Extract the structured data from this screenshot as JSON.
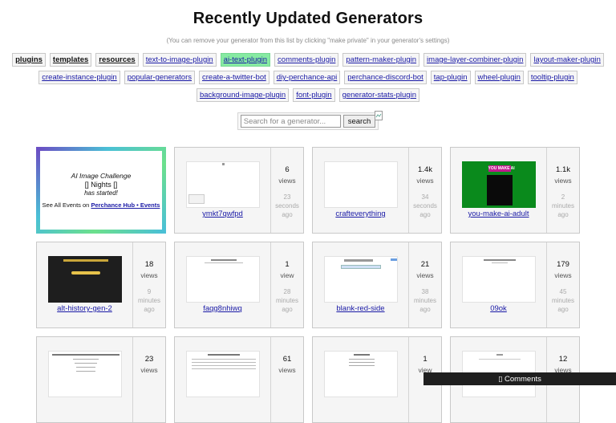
{
  "page": {
    "title": "Recently Updated Generators",
    "subtitle": "(You can remove your generator from this list by clicking \"make private\" in your generator's settings)"
  },
  "tags": [
    {
      "label": "plugins",
      "style": "bold"
    },
    {
      "label": "templates",
      "style": "bold"
    },
    {
      "label": "resources",
      "style": "bold"
    },
    {
      "label": "text-to-image-plugin",
      "style": "normal"
    },
    {
      "label": "ai-text-plugin",
      "style": "active"
    },
    {
      "label": "comments-plugin",
      "style": "normal"
    },
    {
      "label": "pattern-maker-plugin",
      "style": "normal"
    },
    {
      "label": "image-layer-combiner-plugin",
      "style": "normal"
    },
    {
      "label": "layout-maker-plugin",
      "style": "normal"
    },
    {
      "label": "create-instance-plugin",
      "style": "normal"
    },
    {
      "label": "popular-generators",
      "style": "normal"
    },
    {
      "label": "create-a-twitter-bot",
      "style": "normal"
    },
    {
      "label": "diy-perchance-api",
      "style": "normal"
    },
    {
      "label": "perchance-discord-bot",
      "style": "normal"
    },
    {
      "label": "tap-plugin",
      "style": "normal"
    },
    {
      "label": "wheel-plugin",
      "style": "normal"
    },
    {
      "label": "tooltip-plugin",
      "style": "normal"
    },
    {
      "label": "background-image-plugin",
      "style": "normal"
    },
    {
      "label": "font-plugin",
      "style": "normal"
    },
    {
      "label": "generator-stats-plugin",
      "style": "normal"
    }
  ],
  "search": {
    "placeholder": "Search for a generator...",
    "button_label": "search"
  },
  "event": {
    "title": "AI Image Challenge",
    "subtitle": "[] Nights []",
    "note": "has started!",
    "link_prefix": "See All Events on",
    "link_label": "Perchance Hub • Events"
  },
  "thumb_texts": {
    "you_make_ai": "YOU MAKE AI"
  },
  "cards": [
    {
      "name": "ymkt7qwfpd",
      "count": "6",
      "count_label": "views",
      "ago": [
        "23",
        "seconds",
        "ago"
      ],
      "thumb": "white"
    },
    {
      "name": "crafteverything",
      "count": "1.4k",
      "count_label": "views",
      "ago": [
        "34",
        "seconds",
        "ago"
      ],
      "thumb": "white"
    },
    {
      "name": "you-make-ai-adult",
      "count": "1.1k",
      "count_label": "views",
      "ago": [
        "2",
        "minutes",
        "ago"
      ],
      "thumb": "green"
    },
    {
      "name": "alt-history-gen-2",
      "count": "18",
      "count_label": "views",
      "ago": [
        "9",
        "minutes",
        "ago"
      ],
      "thumb": "dark"
    },
    {
      "name": "faqg8nhiwq",
      "count": "1",
      "count_label": "view",
      "ago": [
        "28",
        "minutes",
        "ago"
      ],
      "thumb": "white"
    },
    {
      "name": "blank-red-side",
      "count": "21",
      "count_label": "views",
      "ago": [
        "38",
        "minutes",
        "ago"
      ],
      "thumb": "white"
    },
    {
      "name": "09ok",
      "count": "179",
      "count_label": "views",
      "ago": [
        "45",
        "minutes",
        "ago"
      ],
      "thumb": "white"
    },
    {
      "name": "",
      "count": "23",
      "count_label": "views",
      "ago": [],
      "thumb": "white"
    },
    {
      "name": "",
      "count": "61",
      "count_label": "views",
      "ago": [],
      "thumb": "white"
    },
    {
      "name": "",
      "count": "1",
      "count_label": "view",
      "ago": [],
      "thumb": "white"
    },
    {
      "name": "",
      "count": "12",
      "count_label": "views",
      "ago": [],
      "thumb": "white"
    }
  ],
  "comments": {
    "label": "▯ Comments"
  }
}
